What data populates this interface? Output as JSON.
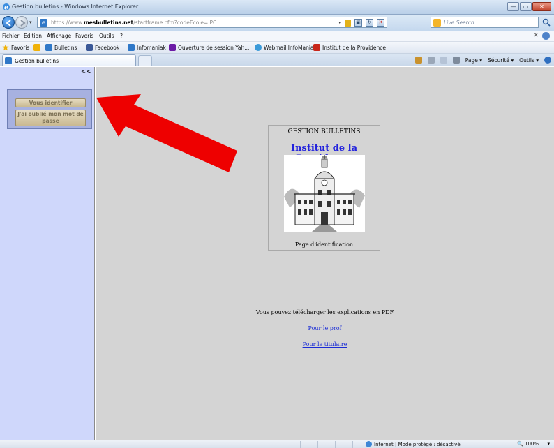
{
  "window": {
    "title": "Gestion bulletins - Windows Internet Explorer",
    "controls": [
      "—",
      "▭",
      "✕"
    ]
  },
  "address": {
    "url_prefix": "https://www.",
    "url_host": "mesbulletins.net",
    "url_path": "/startframe.cfm?codeEcole=IPC",
    "search_placeholder": "Live Search"
  },
  "menu": [
    "Fichier",
    "Edition",
    "Affichage",
    "Favoris",
    "Outils",
    "?"
  ],
  "favorites": {
    "label": "Favoris",
    "items": [
      "Bulletins",
      "Facebook",
      "Infomaniak",
      "Ouverture de session Yah...",
      "Webmail InfoManiak",
      "Institut de la Providence"
    ]
  },
  "tab": {
    "label": "Gestion bulletins"
  },
  "command_bar": {
    "page": "Page ▾",
    "securite": "Sécurité ▾",
    "outils": "Outils ▾"
  },
  "sidebar": {
    "collapse": "<<",
    "btn_login": "Vous identifier",
    "btn_forgot": "J'ai oublié mon mot de passe"
  },
  "card": {
    "heading": "GESTION BULLETINS",
    "school": "Institut de la Providence",
    "caption": "Page d'identification"
  },
  "info": {
    "text": "Vous pouvez télécharger les explications en PDF",
    "link_prof": "Pour le prof",
    "link_titulaire": "Pour le titulaire"
  },
  "status": {
    "zone": "Internet | Mode protégé : désactivé",
    "zoom": "100%"
  },
  "colors": {
    "sidebar_bg": "#cfd7fb",
    "content_bg": "#d4d4d4",
    "school_title": "#2222dd",
    "link": "#1a2cd6",
    "annotation_arrow": "#ee0000"
  }
}
